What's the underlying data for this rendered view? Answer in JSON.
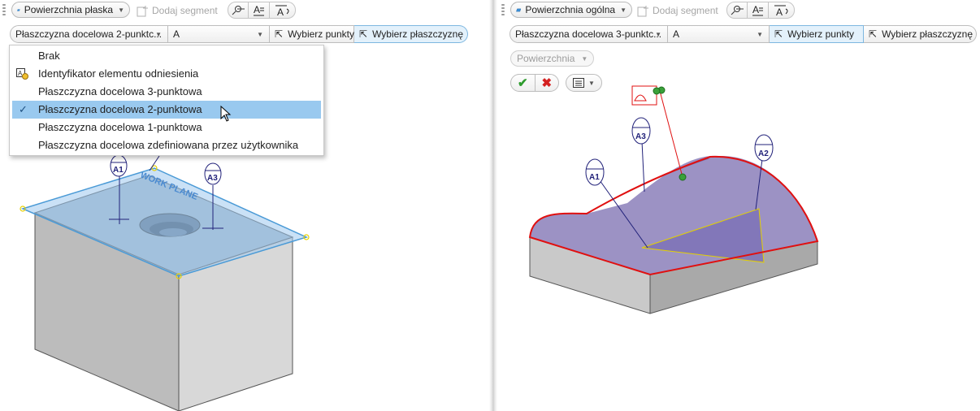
{
  "left": {
    "toolbar": {
      "surface_type": "Powierzchnia płaska",
      "add_segment": "Dodaj segment"
    },
    "target_combo": "Płaszczyzna docelowa 2-punktc...",
    "datum_combo": "A",
    "select_points": "Wybierz punkty",
    "select_plane": "Wybierz płaszczyznę",
    "dropdown": [
      {
        "label": "Brak",
        "icon": "",
        "selected": false
      },
      {
        "label": "Identyfikator elementu odniesienia",
        "icon": "datum-identifier-icon",
        "selected": false
      },
      {
        "label": "Płaszczyzna docelowa 3-punktowa",
        "icon": "",
        "selected": false
      },
      {
        "label": "Płaszczyzna docelowa 2-punktowa",
        "icon": "check-icon",
        "selected": true
      },
      {
        "label": "Płaszczyzna docelowa 1-punktowa",
        "icon": "",
        "selected": false
      },
      {
        "label": "Płaszczyzna docelowa zdefiniowana przez użytkownika",
        "icon": "",
        "selected": false
      }
    ],
    "callouts": [
      "A1",
      "A3"
    ],
    "plane_text": "WORK PLANE"
  },
  "right": {
    "toolbar": {
      "surface_type": "Powierzchnia ogólna",
      "add_segment": "Dodaj segment"
    },
    "target_combo": "Płaszczyzna docelowa 3-punktc...",
    "datum_combo": "A",
    "select_points": "Wybierz punkty",
    "select_plane": "Wybierz płaszczyznę",
    "surface_combo": "Powierzchnia",
    "callouts": [
      "A1",
      "A3",
      "A2"
    ]
  },
  "colors": {
    "accent_blue": "#99c9ef",
    "ok_green": "#2e9b2e",
    "cancel_red": "#d42020",
    "highlight_red": "#e01010"
  }
}
